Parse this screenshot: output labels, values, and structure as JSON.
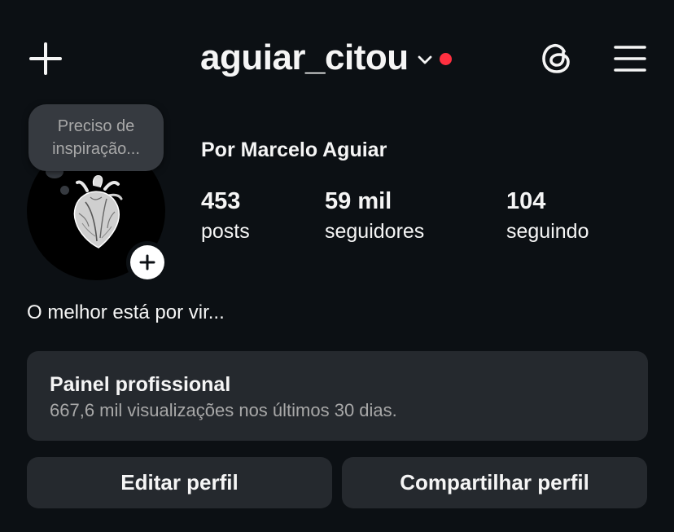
{
  "header": {
    "username": "aguiar_citou",
    "icons": {
      "create": "plus-icon",
      "account_switch": "chevron-down-icon",
      "threads": "threads-icon",
      "menu": "hamburger-menu-icon"
    },
    "notification_dot_color": "#ff3040"
  },
  "note": {
    "text": "Preciso de\ninspiração..."
  },
  "profile": {
    "display_name": "Por Marcelo Aguiar",
    "avatar_icon": "anatomical-heart-image",
    "stats": [
      {
        "value": "453",
        "label": "posts"
      },
      {
        "value": "59 mil",
        "label": "seguidores"
      },
      {
        "value": "104",
        "label": "seguindo"
      }
    ],
    "bio": "O melhor está por vir..."
  },
  "dashboard": {
    "title": "Painel profissional",
    "subtitle": "667,6 mil visualizações nos últimos 30 dias."
  },
  "buttons": {
    "edit_profile": "Editar perfil",
    "share_profile": "Compartilhar perfil"
  },
  "colors": {
    "background": "#0c1014",
    "surface": "#25292e",
    "note_bubble": "#363a40",
    "text_primary": "#f5f5f5",
    "text_secondary": "#a8a8a8"
  }
}
